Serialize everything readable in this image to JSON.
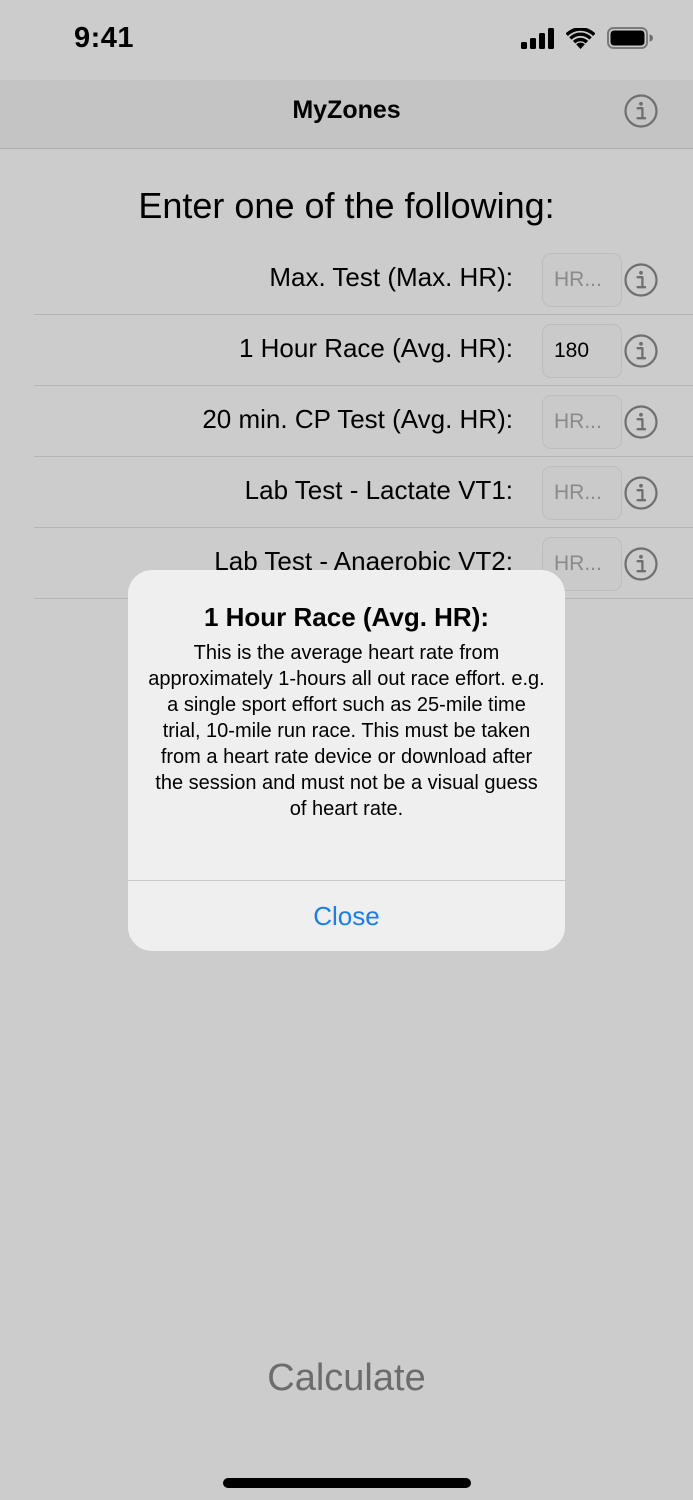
{
  "status_bar": {
    "time": "9:41"
  },
  "nav": {
    "title": "MyZones",
    "info_icon": "info-circle-icon"
  },
  "heading": "Enter one of the following:",
  "rows": [
    {
      "label": "Max. Test (Max. HR):",
      "value": "",
      "placeholder": "HR..."
    },
    {
      "label": "1 Hour Race (Avg. HR):",
      "value": "180",
      "placeholder": "HR..."
    },
    {
      "label": "20 min. CP Test (Avg. HR):",
      "value": "",
      "placeholder": "HR..."
    },
    {
      "label": "Lab Test - Lactate VT1:",
      "value": "",
      "placeholder": "HR..."
    },
    {
      "label": "Lab Test - Anaerobic VT2:",
      "value": "",
      "placeholder": "HR..."
    }
  ],
  "dialog": {
    "title": "1 Hour Race (Avg. HR):",
    "message": "This is the average heart rate from approximately 1-hours all out race effort. e.g. a single sport effort such as 25-mile time trial, 10-mile run race. This must be taken from a heart rate device or download after the session and must not be a visual guess of heart rate.",
    "close_label": "Close"
  },
  "calculate_label": "Calculate",
  "colors": {
    "background": "#cccccc",
    "dialog_background": "#efefef",
    "accent": "#1a7df3",
    "calculate_text": "#6c6c6c"
  }
}
